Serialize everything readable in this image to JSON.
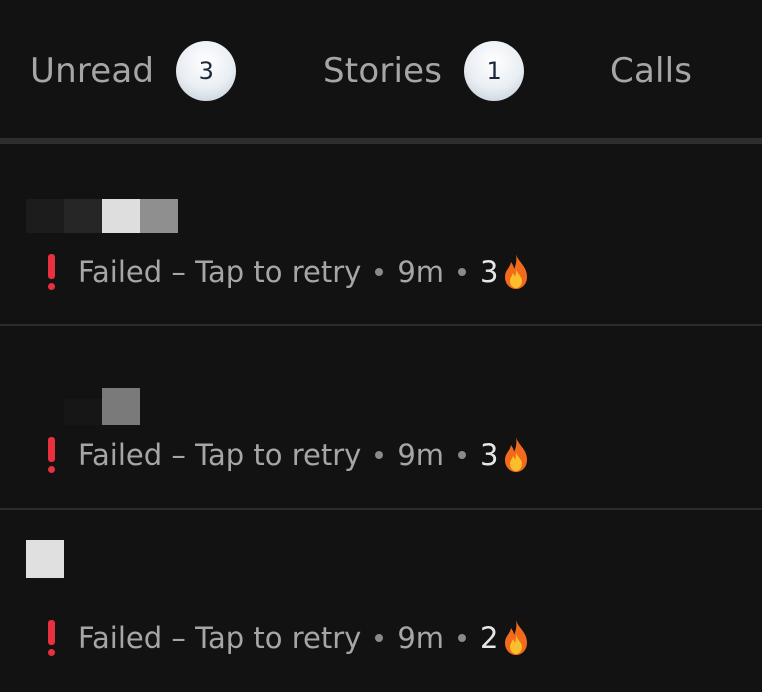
{
  "tabs": [
    {
      "label": "Unread",
      "badge": "3"
    },
    {
      "label": "Stories",
      "badge": "1"
    },
    {
      "label": "Calls"
    }
  ],
  "chats": [
    {
      "status": "Failed – Tap to retry",
      "time": "9m",
      "streak": "3"
    },
    {
      "status": "Failed – Tap to retry",
      "time": "9m",
      "streak": "3"
    },
    {
      "status": "Failed – Tap to retry",
      "time": "9m",
      "streak": "2"
    }
  ],
  "colors": {
    "background": "#121212",
    "alert": "#e8303e",
    "badge": "#e9eef3"
  },
  "icons": {
    "status": "alert-exclamation-icon",
    "streak": "fire-icon"
  }
}
